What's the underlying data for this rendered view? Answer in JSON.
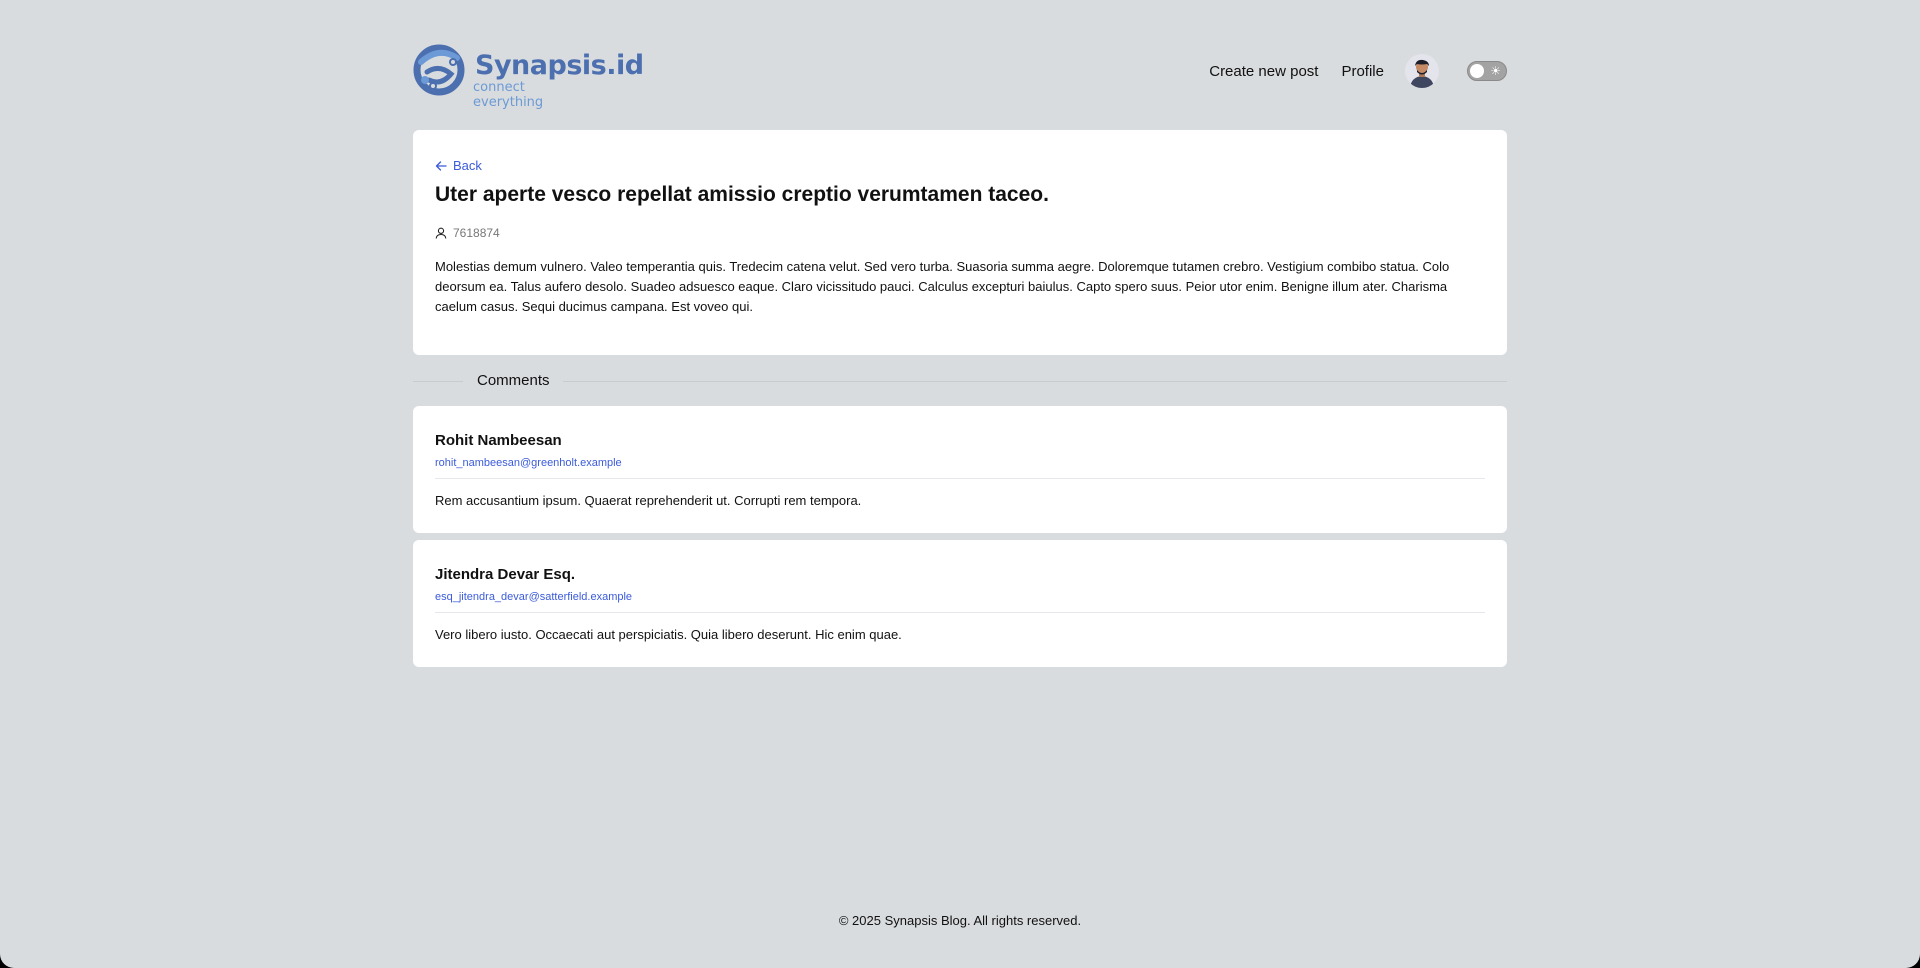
{
  "header": {
    "logo_text": "Synapsis.id",
    "logo_tagline": "connect everything",
    "nav": {
      "create_post": "Create new post",
      "profile": "Profile"
    },
    "theme_toggle_icon": "sun-icon"
  },
  "post": {
    "back_label": "Back",
    "title": "Uter aperte vesco repellat amissio creptio verumtamen taceo.",
    "author_id": "7618874",
    "body": "Molestias demum vulnero. Valeo temperantia quis. Tredecim catena velut. Sed vero turba. Suasoria summa aegre. Doloremque tutamen crebro. Vestigium combibo statua. Colo deorsum ea. Talus aufero desolo. Suadeo adsuesco eaque. Claro vicissitudo pauci. Calculus excepturi baiulus. Capto spero suus. Peior utor enim. Benigne illum ater. Charisma caelum casus. Sequi ducimus campana. Est voveo qui."
  },
  "comments": {
    "heading": "Comments",
    "items": [
      {
        "name": "Rohit Nambeesan",
        "email": "rohit_nambeesan@greenholt.example",
        "body": "Rem accusantium ipsum. Quaerat reprehenderit ut. Corrupti rem tempora."
      },
      {
        "name": "Jitendra Devar Esq.",
        "email": "esq_jitendra_devar@satterfield.example",
        "body": "Vero libero iusto. Occaecati aut perspiciatis. Quia libero deserunt. Hic enim quae."
      }
    ]
  },
  "footer": {
    "text": "© 2025 Synapsis Blog. All rights reserved."
  },
  "colors": {
    "background": "#d9dcde",
    "card": "#ffffff",
    "accent_link": "#3b5bdb",
    "logo": "#4c6fb0"
  }
}
